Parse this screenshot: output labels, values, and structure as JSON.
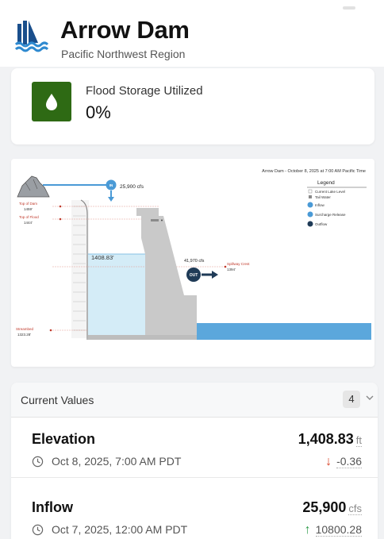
{
  "header": {
    "title": "Arrow Dam",
    "subtitle": "Pacific Northwest Region",
    "logo_icon": "dam-icon"
  },
  "flood_storage": {
    "label": "Flood Storage Utilized",
    "value": "0%",
    "icon": "water-drop-icon",
    "icon_color": "#2e6a14"
  },
  "diagram": {
    "caption": "Arrow Dam - October 8, 2025 at 7:00 AM Pacific Time",
    "legend_title": "Legend",
    "legend_items": [
      "Current Lake Level",
      "Tail Water",
      "Inflow",
      "Surcharge Release",
      "Outflow"
    ],
    "inflow_value": "25,900 cfs",
    "inflow_badge": "IN",
    "outflow_value": "41,970 cfs",
    "outflow_badge": "OUT",
    "current_level": "1408.83'",
    "top_of_dam_label": "Top of Dam",
    "top_of_dam_value": "1459'",
    "top_of_flood_label": "Top of Flood",
    "top_of_flood_value": "1444'",
    "spillway_label": "Spillway Crest",
    "spillway_value": "1394'",
    "streambed_label": "Streambed",
    "streambed_value": "1323.28'",
    "colors": {
      "water": "#d4ecf7",
      "tailwater": "#5ba7dc",
      "dam": "#c9c9c9",
      "marker_red": "#c0392b",
      "badge": "#4a9ad6",
      "out_badge": "#1f3b57"
    }
  },
  "current_values": {
    "title": "Current Values",
    "count": "4",
    "rows": [
      {
        "name": "Elevation",
        "value": "1,408.83",
        "unit": "ft",
        "timestamp": "Oct 8, 2025, 7:00 AM PDT",
        "delta": "-0.36",
        "trend": "down"
      },
      {
        "name": "Inflow",
        "value": "25,900",
        "unit": "cfs",
        "timestamp": "Oct 7, 2025, 12:00 AM PDT",
        "delta": "10800.28",
        "trend": "up"
      }
    ]
  }
}
